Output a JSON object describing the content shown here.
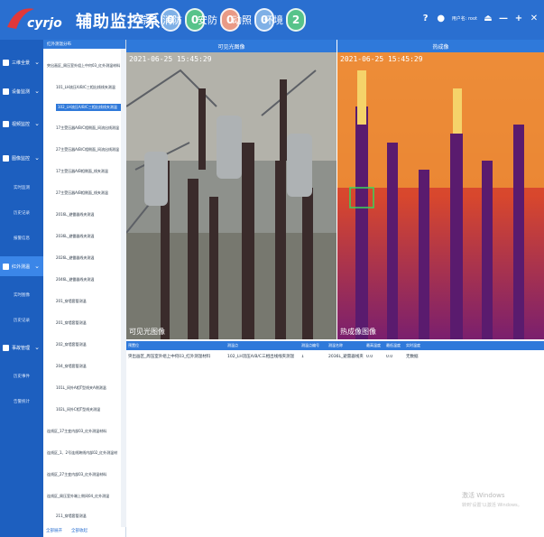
{
  "header": {
    "logo_text": "cyrjo",
    "title": "辅助监控系统",
    "stats": [
      {
        "label": "综自",
        "value": "0",
        "color": "#7fb0e6"
      },
      {
        "label": "消防",
        "value": "0",
        "color": "#57c38a"
      },
      {
        "label": "安防",
        "value": "0",
        "color": "#e99a86"
      },
      {
        "label": "动照",
        "value": "0",
        "color": "#7fb0e6"
      },
      {
        "label": "环境",
        "value": "2",
        "color": "#57c38a"
      }
    ],
    "user_text": "用户名: root"
  },
  "sidebar": {
    "items": [
      {
        "label": "三维全景",
        "icon": "cube-icon"
      },
      {
        "label": "设备监测",
        "icon": "monitor-icon"
      },
      {
        "label": "视频监控",
        "icon": "camera-icon"
      },
      {
        "label": "图像监控",
        "icon": "image-icon"
      },
      {
        "label": "红外测温",
        "icon": "thermometer-icon"
      },
      {
        "label": "事故管理",
        "icon": "warning-icon"
      }
    ],
    "subitems_1": [
      "实时监测",
      "历史记录",
      "报警信息"
    ],
    "subitems_2": [
      "实时图像",
      "历史记录"
    ],
    "subitems_3": [
      "历史事件",
      "告警统计"
    ]
  },
  "tree": {
    "title": "红外测温分布",
    "nodes": [
      "突出画区_周压室外组上中何03_红外测温材料",
      "101_LH流压A/B/C三相出线线夹测温",
      "102_LH流压A/B/C三相出线线夹测温",
      "17主受压器A/B/C相侧面_间流出线测温",
      "27主受压器A/B/C相侧面_间流出线测温",
      "17主受压器A/B相侧面_线夹测温",
      "27主受压器A/B相侧面_线夹测温",
      "2016L_避雷器线夹测温",
      "2036L_避雷器线夹测温",
      "2026L_避雷器线夹测温",
      "2046L_避雷器线夹测温",
      "201_穿墙套管测温",
      "201_穿墙套管测温",
      "202_穿墙套管测温",
      "204_穿墙套管测温",
      "101L_间外A相T型线夹A侧测温",
      "102L_间外C相T型线夹测温",
      "连线区_17主变内部03_红外测温材料",
      "连线区_1、2号连线跨线内部02_红外测温材",
      "连线区_27主变内部03_红外测温材料",
      "连线区_周压室外端上侧间04_红外测温",
      "211_穿墙套管测温"
    ],
    "footer": [
      "全部展开",
      "全部收起"
    ]
  },
  "video": {
    "visible_title": "可见光图像",
    "ir_title": "热成像",
    "visible_timestamp": "2021-06-25 15:45:29",
    "ir_timestamp": "2021-06-25 15:45:29",
    "visible_caption": "可见光图像",
    "ir_caption": "热成像图像"
  },
  "table": {
    "headers": [
      "预置位",
      "测温点",
      "测温点编号",
      "测温名称",
      "最高温度",
      "最低温度",
      "实时温度"
    ],
    "rows": [
      [
        "突出画区_周压室外组上中何03_红外测温材料",
        "102_LH流压A/B/C三相出线线夹测温",
        "1",
        "2036L_避雷器线夹",
        "0.0",
        "0.0",
        "无数据"
      ]
    ]
  },
  "watermark": {
    "line1": "激活 Windows",
    "line2": "转到'设置'以激活 Windows。"
  }
}
